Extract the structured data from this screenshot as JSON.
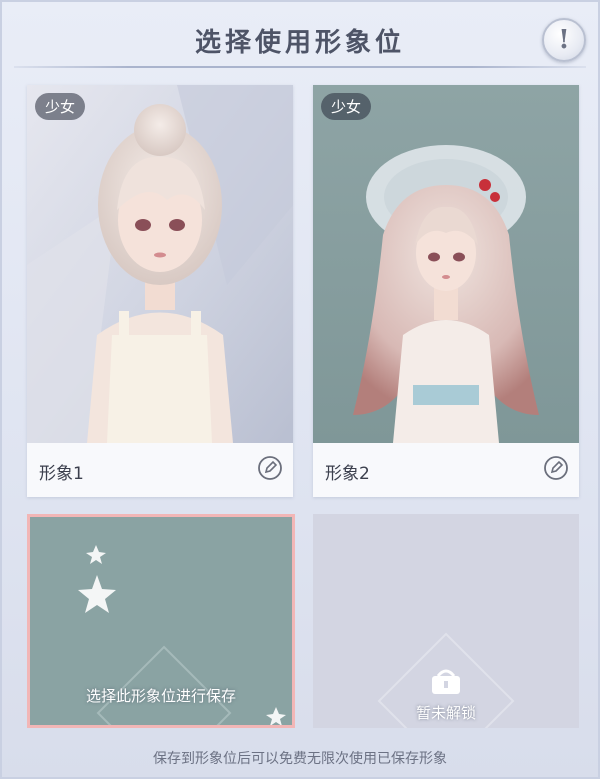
{
  "title": "选择使用形象位",
  "info_button": "!",
  "cards": [
    {
      "badge": "少女",
      "name": "形象1",
      "icon": "edit-icon"
    },
    {
      "badge": "少女",
      "name": "形象2",
      "icon": "edit-icon"
    }
  ],
  "empty_slot": {
    "text": "选择此形象位进行保存"
  },
  "locked_slot": {
    "text": "暂未解锁",
    "icon": "lock-icon"
  },
  "footnote": "保存到形象位后可以免费无限次使用已保存形象",
  "colors": {
    "background": "#e3e7f3",
    "empty_slot_bg": "#8aa3a3",
    "locked_slot_bg": "#d3d5e2",
    "selected_border": "#f2b6b6",
    "title_text": "#4e5467"
  }
}
